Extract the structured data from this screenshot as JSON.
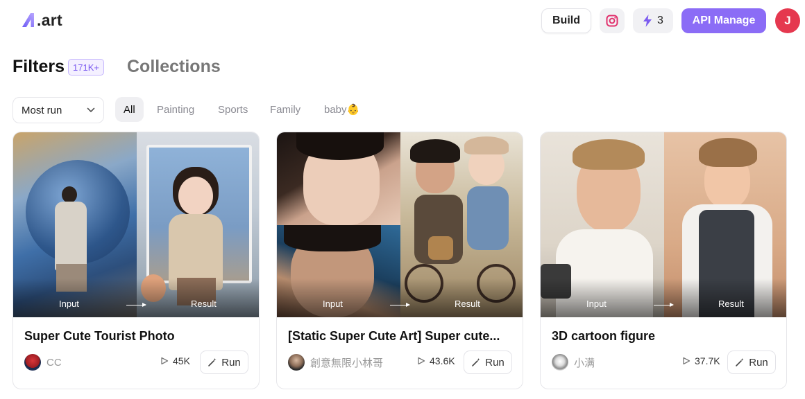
{
  "header": {
    "logo_text": ".art",
    "build_label": "Build",
    "credits": "3",
    "api_label": "API Manage",
    "avatar_initial": "J"
  },
  "tabs": {
    "filters_label": "Filters",
    "filters_count": "171K+",
    "collections_label": "Collections"
  },
  "sort": {
    "selected": "Most run"
  },
  "chips": [
    "All",
    "Painting",
    "Sports",
    "Family",
    "baby👶"
  ],
  "colors": {
    "accent": "#8b6cf6",
    "avatar": "#e5384f"
  },
  "cards": [
    {
      "title": "Super Cute Tourist Photo",
      "author": "CC",
      "runs": "45K",
      "run_label": "Run",
      "input_label": "Input",
      "result_label": "Result"
    },
    {
      "title": "[Static Super Cute Art] Super cute...",
      "author": "創意無限小林哥",
      "runs": "43.6K",
      "run_label": "Run",
      "input_label": "Input",
      "result_label": "Result"
    },
    {
      "title": "3D cartoon figure",
      "author": "小满",
      "runs": "37.7K",
      "run_label": "Run",
      "input_label": "Input",
      "result_label": "Result"
    }
  ]
}
